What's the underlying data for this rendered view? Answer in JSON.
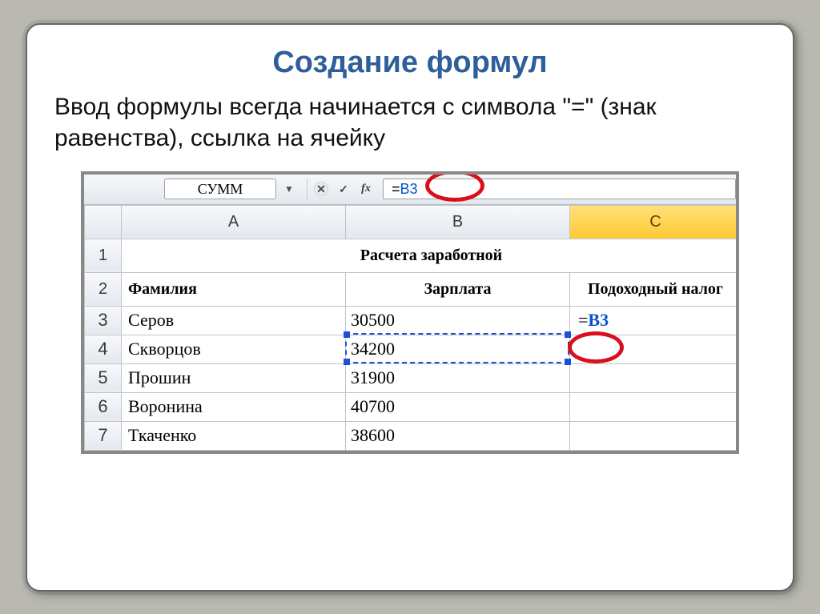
{
  "title": "Создание формул",
  "intro": "Ввод формулы всегда начинается с символа \"=\" (знак равенства), ссылка на ячейку",
  "formula_bar": {
    "name_box": "СУММ",
    "fx_label": "fx",
    "formula_eq": "=",
    "formula_ref": "B3"
  },
  "columns": [
    "A",
    "B",
    "C"
  ],
  "header_row": {
    "merged_title": "Расчета заработной"
  },
  "labels_row": {
    "A": "Фамилия",
    "B": "Зарплата",
    "C": "Подоходный налог"
  },
  "rows": [
    {
      "n": "3",
      "A": "Серов",
      "B": "30500",
      "C_eq": "=",
      "C_ref": "B3"
    },
    {
      "n": "4",
      "A": "Скворцов",
      "B": "34200",
      "C": ""
    },
    {
      "n": "5",
      "A": "Прошин",
      "B": "31900",
      "C": ""
    },
    {
      "n": "6",
      "A": "Воронина",
      "B": "40700",
      "C": ""
    },
    {
      "n": "7",
      "A": "Ткаченко",
      "B": "38600",
      "C": ""
    }
  ],
  "row_numbers_extra": [
    "1",
    "2"
  ]
}
